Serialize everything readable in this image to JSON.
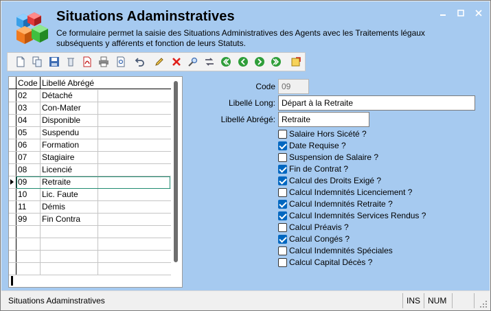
{
  "window": {
    "title": "Situations Adaminstratives",
    "subtitle": "Ce formulaire permet la saisie des Situations Administratives des Agents avec les Traitements légaux subséquents y afférents et fonction de leurs Statuts.",
    "controls": [
      "minimize",
      "maximize",
      "close"
    ]
  },
  "toolbar": {
    "icons": [
      "new-icon",
      "copy-icon",
      "save-icon",
      "delete-icon",
      "pdf-icon",
      "print-icon",
      "preview-icon",
      "undo-icon",
      "edit-icon",
      "cancel-icon",
      "search-icon",
      "refresh-icon",
      "first-icon",
      "previous-icon",
      "next-icon",
      "last-icon",
      "exit-icon"
    ]
  },
  "grid": {
    "headers": {
      "code": "Code",
      "libelle": "Libellé Abrégé"
    },
    "rows": [
      {
        "code": "02",
        "libelle": "Détaché"
      },
      {
        "code": "03",
        "libelle": "Con-Mater"
      },
      {
        "code": "04",
        "libelle": "Disponible"
      },
      {
        "code": "05",
        "libelle": "Suspendu"
      },
      {
        "code": "06",
        "libelle": "Formation"
      },
      {
        "code": "07",
        "libelle": "Stagiaire"
      },
      {
        "code": "08",
        "libelle": "Licencié"
      },
      {
        "code": "09",
        "libelle": "Retraite"
      },
      {
        "code": "10",
        "libelle": "Lic. Faute"
      },
      {
        "code": "11",
        "libelle": "Démis"
      },
      {
        "code": "99",
        "libelle": "Fin Contra"
      },
      {
        "code": "",
        "libelle": ""
      },
      {
        "code": "",
        "libelle": ""
      },
      {
        "code": "",
        "libelle": ""
      },
      {
        "code": "",
        "libelle": ""
      }
    ],
    "selected_index": 7
  },
  "form": {
    "code_label": "Code",
    "code_value": "09",
    "libelle_long_label": "Libellé Long:",
    "libelle_long_value": "Départ à la Retraite",
    "libelle_abrege_label": "Libellé Abrégé:",
    "libelle_abrege_value": "Retraite",
    "checkboxes": [
      {
        "label": "Salaire Hors Sicété ?",
        "checked": false
      },
      {
        "label": "Date Requise ?",
        "checked": true
      },
      {
        "label": "Suspension de Salaire ?",
        "checked": false
      },
      {
        "label": "Fin de Contrat ?",
        "checked": true
      },
      {
        "label": "Calcul des Droits Exigé ?",
        "checked": true
      },
      {
        "label": "Calcul Indemnités Licenciement ?",
        "checked": false
      },
      {
        "label": "Calcul Indemnités Retraite ?",
        "checked": true
      },
      {
        "label": "Calcul Indemnités Services Rendus ?",
        "checked": true
      },
      {
        "label": "Calcul Préavis ?",
        "checked": false
      },
      {
        "label": "Calcul Congés ?",
        "checked": true
      },
      {
        "label": "Calcul Indemnités Spéciales",
        "checked": false
      },
      {
        "label": "Calcul Capital Décès ?",
        "checked": false
      }
    ]
  },
  "statusbar": {
    "text": "Situations Adaminstratives",
    "ins": "INS",
    "num": "NUM"
  },
  "colors": {
    "background": "#a6caf0",
    "checkbox_checked": "#0067c0",
    "selection_border": "#1f8a70"
  }
}
